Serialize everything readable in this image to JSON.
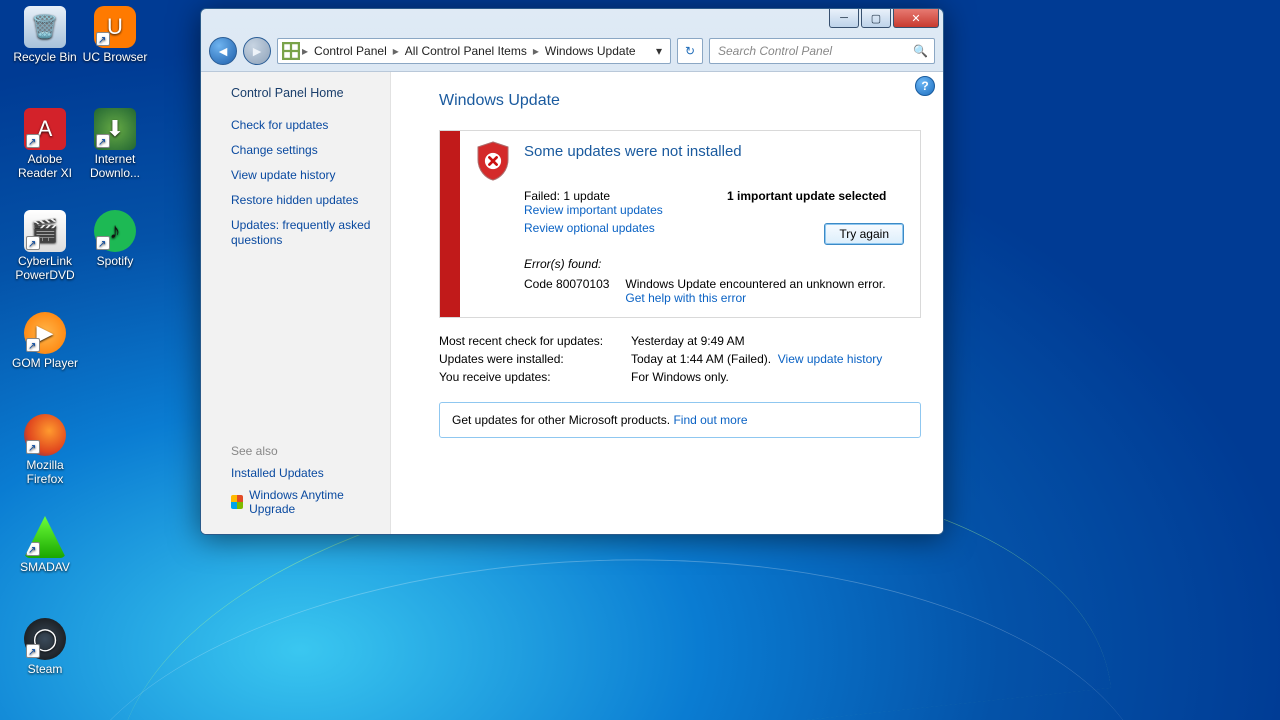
{
  "desktop_icons": [
    {
      "name": "Recycle Bin"
    },
    {
      "name": "UC Browser"
    },
    {
      "name": "Adobe Reader XI"
    },
    {
      "name": "Internet Downlo..."
    },
    {
      "name": "CyberLink PowerDVD"
    },
    {
      "name": "Spotify"
    },
    {
      "name": "GOM Player"
    },
    {
      "name": "Mozilla Firefox"
    },
    {
      "name": "SMADAV"
    },
    {
      "name": "Steam"
    }
  ],
  "breadcrumb": {
    "seg1": "Control Panel",
    "seg2": "All Control Panel Items",
    "seg3": "Windows Update"
  },
  "search": {
    "placeholder": "Search Control Panel"
  },
  "sidebar": {
    "home": "Control Panel Home",
    "tasks": [
      "Check for updates",
      "Change settings",
      "View update history",
      "Restore hidden updates",
      "Updates: frequently asked questions"
    ],
    "see_also_hdr": "See also",
    "see_also": [
      "Installed Updates",
      "Windows Anytime Upgrade"
    ]
  },
  "page_title": "Windows Update",
  "status": {
    "headline": "Some updates were not installed",
    "failed_line": "Failed: 1 update",
    "review_important": "Review important updates",
    "review_optional": "Review optional updates",
    "selected_line": "1 important update selected",
    "try_again": "Try again",
    "errors_found": "Error(s) found:",
    "error_code": "Code 80070103",
    "error_desc": "Windows Update encountered an unknown error.",
    "get_help": "Get help with this error"
  },
  "kv": {
    "k1": "Most recent check for updates:",
    "v1": "Yesterday at 9:49 AM",
    "k2": "Updates were installed:",
    "v2_a": "Today at 1:44 AM (Failed).",
    "v2_link": "View update history",
    "k3": "You receive updates:",
    "v3": "For Windows only."
  },
  "other_products": {
    "text": "Get updates for other Microsoft products.",
    "link": "Find out more"
  }
}
